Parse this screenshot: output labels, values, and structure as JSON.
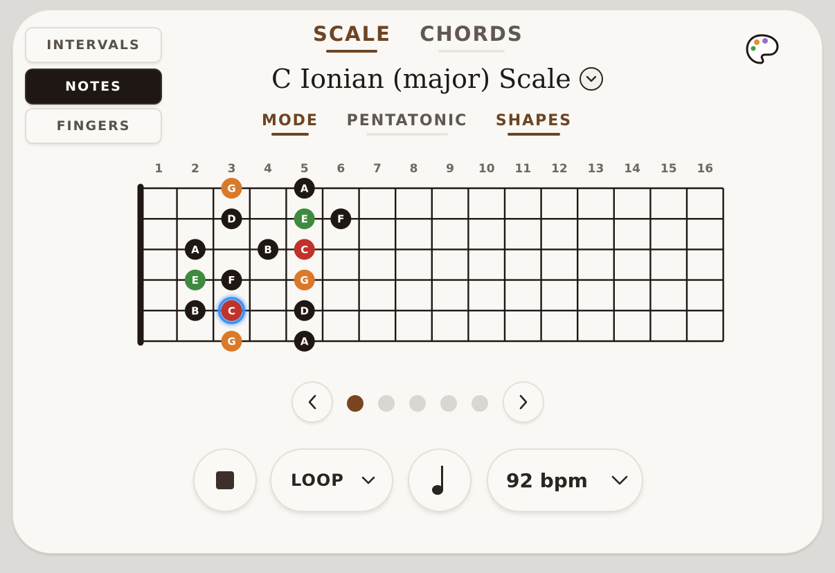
{
  "view_buttons": [
    {
      "label": "INTERVALS",
      "active": false
    },
    {
      "label": "NOTES",
      "active": true
    },
    {
      "label": "FINGERS",
      "active": false
    }
  ],
  "top_tabs": [
    {
      "label": "SCALE",
      "active": true
    },
    {
      "label": "CHORDS",
      "active": false
    }
  ],
  "title": "C Ionian (major) Scale",
  "sub_tabs": [
    {
      "label": "MODE",
      "active": true
    },
    {
      "label": "PENTATONIC",
      "active": false
    },
    {
      "label": "SHAPES",
      "active": true
    }
  ],
  "fret_numbers": [
    "1",
    "2",
    "3",
    "4",
    "5",
    "6",
    "7",
    "8",
    "9",
    "10",
    "11",
    "12",
    "13",
    "14",
    "15",
    "16"
  ],
  "notes": [
    {
      "string": 1,
      "fret": 3,
      "label": "G",
      "color": "orange"
    },
    {
      "string": 1,
      "fret": 5,
      "label": "A",
      "color": "black"
    },
    {
      "string": 2,
      "fret": 3,
      "label": "D",
      "color": "black"
    },
    {
      "string": 2,
      "fret": 5,
      "label": "E",
      "color": "green"
    },
    {
      "string": 2,
      "fret": 6,
      "label": "F",
      "color": "black"
    },
    {
      "string": 3,
      "fret": 2,
      "label": "A",
      "color": "black"
    },
    {
      "string": 3,
      "fret": 4,
      "label": "B",
      "color": "black"
    },
    {
      "string": 3,
      "fret": 5,
      "label": "C",
      "color": "red"
    },
    {
      "string": 4,
      "fret": 2,
      "label": "E",
      "color": "green"
    },
    {
      "string": 4,
      "fret": 3,
      "label": "F",
      "color": "black"
    },
    {
      "string": 4,
      "fret": 5,
      "label": "G",
      "color": "orange"
    },
    {
      "string": 5,
      "fret": 2,
      "label": "B",
      "color": "black"
    },
    {
      "string": 5,
      "fret": 3,
      "label": "C",
      "color": "red",
      "highlighted": true
    },
    {
      "string": 5,
      "fret": 5,
      "label": "D",
      "color": "black"
    },
    {
      "string": 6,
      "fret": 3,
      "label": "G",
      "color": "orange"
    },
    {
      "string": 6,
      "fret": 5,
      "label": "A",
      "color": "black"
    }
  ],
  "note_colors": {
    "black": "#1f1714",
    "orange": "#d9792a",
    "green": "#3f8a3e",
    "red": "#c0322b"
  },
  "pagination": {
    "pages": 5,
    "current": 1
  },
  "controls": {
    "loop_label": "LOOP",
    "tempo_label": "92 bpm"
  },
  "colors": {
    "accent": "#6e4424",
    "highlight": "#3a8ff0"
  }
}
